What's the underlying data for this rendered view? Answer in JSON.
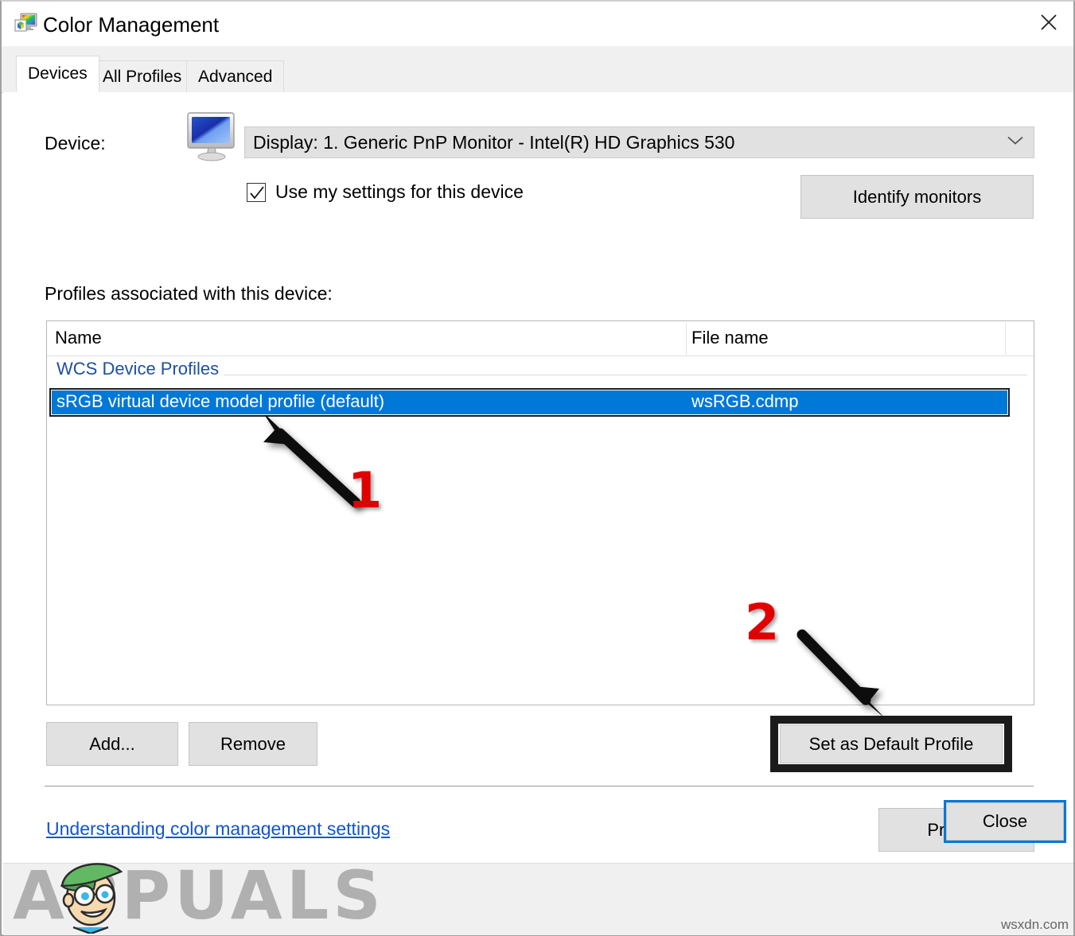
{
  "window": {
    "title": "Color Management",
    "icon": "color-management-icon",
    "close_icon": "close-icon"
  },
  "tabs": [
    {
      "label": "Devices",
      "active": true
    },
    {
      "label": "All Profiles",
      "active": false
    },
    {
      "label": "Advanced",
      "active": false
    }
  ],
  "device_section": {
    "label": "Device:",
    "icon": "monitor-icon",
    "combo_value": "Display: 1. Generic PnP Monitor - Intel(R) HD Graphics 530",
    "combo_arrow_icon": "chevron-down-icon",
    "checkbox_label": "Use my settings for this device",
    "checkbox_checked": true,
    "identify_monitors_label": "Identify monitors"
  },
  "profiles_section": {
    "heading": "Profiles associated with this device:",
    "columns": [
      "Name",
      "File name"
    ],
    "group_label": "WCS Device Profiles",
    "rows": [
      {
        "name": "sRGB virtual device model profile (default)",
        "file_name": "wsRGB.cdmp",
        "selected": true
      }
    ],
    "add_label": "Add...",
    "remove_label": "Remove",
    "set_default_label": "Set as Default Profile"
  },
  "footer": {
    "help_link": "Understanding color management settings",
    "profiles_label": "Profiles",
    "close_label": "Close"
  },
  "annotations": [
    {
      "number": "1",
      "target": "selected-profile-row"
    },
    {
      "number": "2",
      "target": "set-as-default-profile-button"
    }
  ],
  "watermark": {
    "text": "APPUALS",
    "credit": "wsxdn.com"
  },
  "colors": {
    "selection_blue": "#0078d7",
    "link_blue": "#1155cc",
    "group_blue": "#1f4fa0",
    "annotation_red": "#e00000",
    "button_face": "#e1e1e1",
    "dialog_face": "#f0f0f0"
  }
}
